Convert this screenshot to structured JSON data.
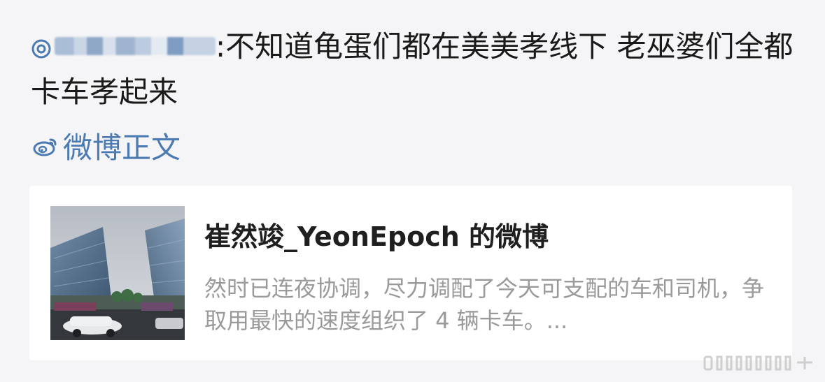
{
  "comment": {
    "username_hint": "@",
    "text": ":不知道龟蛋们都在美美孝线下 老巫婆们全都卡车孝起来"
  },
  "source_link": {
    "label": "微博正文",
    "icon": "weibo-icon"
  },
  "card": {
    "title": "崔然竣_YeonEpoch 的微博",
    "summary": "然时已连夜协调，尽力调配了今天可支配的车和司机，争取用最快的速度组织了 4 辆卡车。...",
    "thumbnail_icon": "city-buildings-photo"
  },
  "colors": {
    "link": "#4c7bb4",
    "background": "#f5f5f7",
    "card": "#ffffff",
    "summary_text": "#9a9a9a"
  }
}
